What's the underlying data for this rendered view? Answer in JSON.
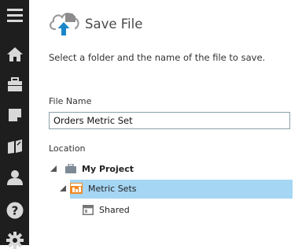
{
  "sidebar": {
    "items": [
      {
        "icon": "menu-icon"
      },
      {
        "icon": "home-icon"
      },
      {
        "icon": "briefcase-icon"
      },
      {
        "icon": "note-icon"
      },
      {
        "icon": "book-icon"
      },
      {
        "icon": "user-icon"
      },
      {
        "icon": "help-icon"
      },
      {
        "icon": "settings-icon"
      }
    ]
  },
  "dialog": {
    "title": "Save File",
    "icon": "cloud-upload-icon",
    "instructions": "Select a folder and the name of the file to save.",
    "file_name_label": "File Name",
    "file_name_value": "Orders Metric Set",
    "location_label": "Location",
    "tree": {
      "project": "My Project",
      "folder": "Metric Sets",
      "shared": "Shared"
    }
  },
  "colors": {
    "sidebar_bg": "#1e1e1e",
    "selection": "#a5d6f3",
    "accent": "#1a86c8"
  }
}
